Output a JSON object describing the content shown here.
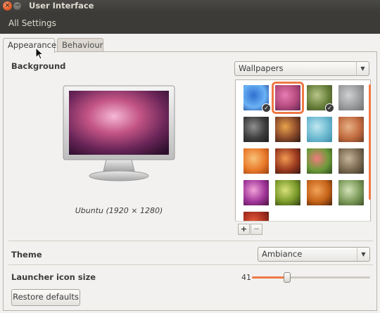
{
  "window": {
    "title": "User Interface",
    "close_icon": "×",
    "minimize_icon": "−"
  },
  "menubar": {
    "all_settings": "All Settings"
  },
  "tabs": [
    {
      "label": "Appearance",
      "active": true
    },
    {
      "label": "Behaviour",
      "active": false
    }
  ],
  "background": {
    "label": "Background",
    "source": "Wallpapers",
    "caption": "Ubuntu  (1920 × 1280)",
    "wallpapers": [
      {
        "name": "blue-curtain",
        "colors": [
          "#2f6fd0",
          "#6ab2f5",
          "#1c3c8d"
        ],
        "checked": true,
        "selected": false
      },
      {
        "name": "ubuntu-default",
        "colors": [
          "#e87bb3",
          "#b34a7c",
          "#5e2552"
        ],
        "checked": false,
        "selected": true
      },
      {
        "name": "grass-field",
        "colors": [
          "#b9c68a",
          "#68803a",
          "#3c4a23"
        ],
        "checked": true,
        "selected": false
      },
      {
        "name": "grey-mist",
        "colors": [
          "#cfd1d2",
          "#9a9c9d",
          "#6e6f70"
        ],
        "checked": false,
        "selected": false
      },
      {
        "name": "dark-cables",
        "colors": [
          "#8f8f8f",
          "#3d3d3d",
          "#1d1d1d"
        ],
        "checked": false,
        "selected": false
      },
      {
        "name": "sunset-road",
        "colors": [
          "#e9a24c",
          "#8a4a2a",
          "#2c1a12"
        ],
        "checked": false,
        "selected": false
      },
      {
        "name": "ice-blue",
        "colors": [
          "#bfe7f1",
          "#6cb9d0",
          "#3d8ba8"
        ],
        "checked": false,
        "selected": false
      },
      {
        "name": "autumn-path",
        "colors": [
          "#e7b085",
          "#c16a3f",
          "#6e3a24"
        ],
        "checked": false,
        "selected": false
      },
      {
        "name": "orange-flower",
        "colors": [
          "#f7c27a",
          "#e97a2a",
          "#9a3e12"
        ],
        "checked": false,
        "selected": false
      },
      {
        "name": "red-sunset",
        "colors": [
          "#f29a52",
          "#9b3a1f",
          "#331611"
        ],
        "checked": false,
        "selected": false
      },
      {
        "name": "pink-blossom",
        "colors": [
          "#f07c7c",
          "#6c9a3a",
          "#2f4a1c"
        ],
        "checked": false,
        "selected": false
      },
      {
        "name": "brown-pencil",
        "colors": [
          "#c6b49a",
          "#7a6a52",
          "#3c3226"
        ],
        "checked": false,
        "selected": false
      },
      {
        "name": "purple-glow",
        "colors": [
          "#f2a2d8",
          "#a0359a",
          "#4a123f"
        ],
        "checked": false,
        "selected": false
      },
      {
        "name": "green-bokeh",
        "colors": [
          "#d8e07a",
          "#7a9a2a",
          "#2f3a12"
        ],
        "checked": false,
        "selected": false
      },
      {
        "name": "orange-fish",
        "colors": [
          "#f3a45a",
          "#c46218",
          "#4a2108"
        ],
        "checked": false,
        "selected": false
      },
      {
        "name": "grass-blades",
        "colors": [
          "#d3e2b8",
          "#7c9a5a",
          "#3e5227"
        ],
        "checked": false,
        "selected": false
      },
      {
        "name": "red-leaves",
        "colors": [
          "#e85b3c",
          "#a32d1f",
          "#4a150f"
        ],
        "checked": false,
        "selected": false
      }
    ],
    "add_label": "+",
    "remove_label": "−",
    "combo_arrow": "▼",
    "accent": "#ef7945"
  },
  "theme": {
    "label": "Theme",
    "value": "Ambiance",
    "combo_arrow": "▼"
  },
  "launcher": {
    "label": "Launcher icon size",
    "value": "41",
    "slider_fraction": 0.3
  },
  "restore_defaults": "Restore defaults",
  "icons": {
    "close": "close-icon",
    "minimize": "minimize-icon",
    "dropdown": "chevron-down-icon",
    "checkmark": "check-icon",
    "pointer": "mouse-pointer-icon"
  }
}
